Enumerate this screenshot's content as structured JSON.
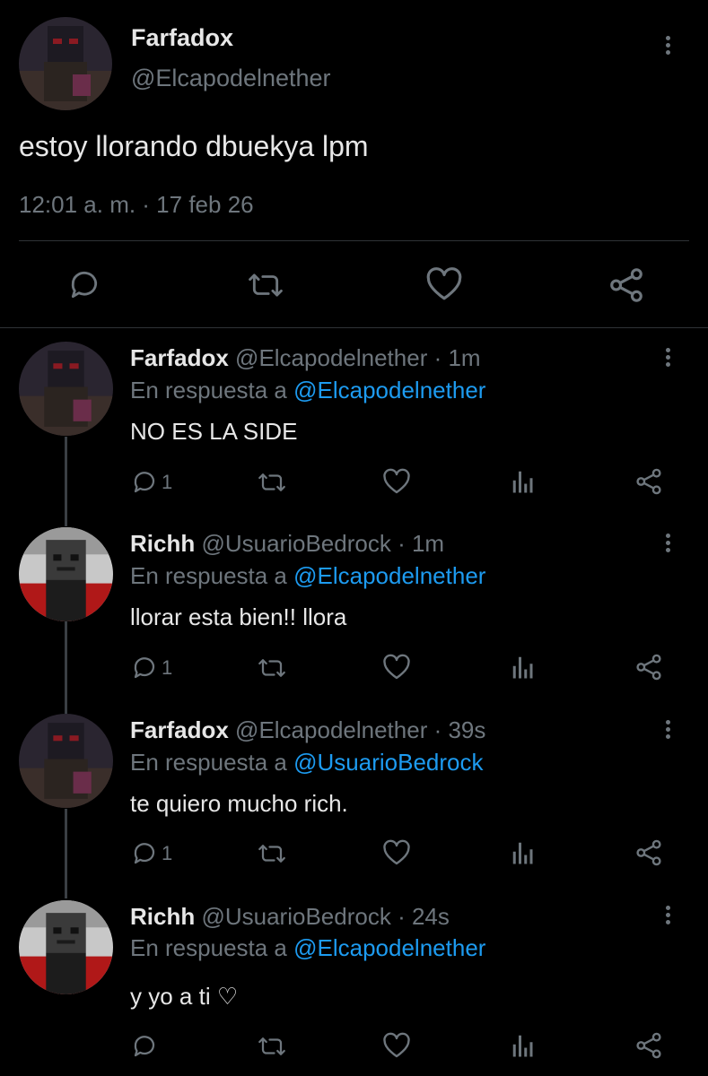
{
  "main_tweet": {
    "display_name": "Farfadox",
    "handle": "@Elcapodelnether",
    "text": "estoy llorando dbuekya lpm",
    "timestamp": "12:01 a. m. · 17 feb 26",
    "actions": [
      "reply-icon",
      "retweet-icon",
      "like-icon",
      "share-icon"
    ]
  },
  "replies": [
    {
      "display_name": "Farfadox",
      "handle": "@Elcapodelnether",
      "time": "· 1m",
      "reply_prefix": "En respuesta a",
      "reply_to": "@Elcapodelnether",
      "text": "NO ES LA SIDE",
      "reply_count": "1"
    },
    {
      "display_name": "Richh",
      "handle": "@UsuarioBedrock",
      "time": "· 1m",
      "reply_prefix": "En respuesta a",
      "reply_to": "@Elcapodelnether",
      "text": "llorar esta bien!! llora",
      "reply_count": "1"
    },
    {
      "display_name": "Farfadox",
      "handle": "@Elcapodelnether",
      "time": "· 39s",
      "reply_prefix": "En respuesta a",
      "reply_to": "@UsuarioBedrock",
      "text": "te quiero mucho rich.",
      "reply_count": "1"
    },
    {
      "display_name": "Richh",
      "handle": "@UsuarioBedrock",
      "time": "· 24s",
      "reply_prefix": "En respuesta a",
      "reply_to": "@Elcapodelnether",
      "text": "y yo a ti ♡",
      "reply_count": ""
    }
  ],
  "colors": {
    "background": "#000000",
    "text": "#d9d9d9",
    "muted": "#6e767d",
    "link": "#1d9bf0",
    "divider": "#2f3336"
  }
}
